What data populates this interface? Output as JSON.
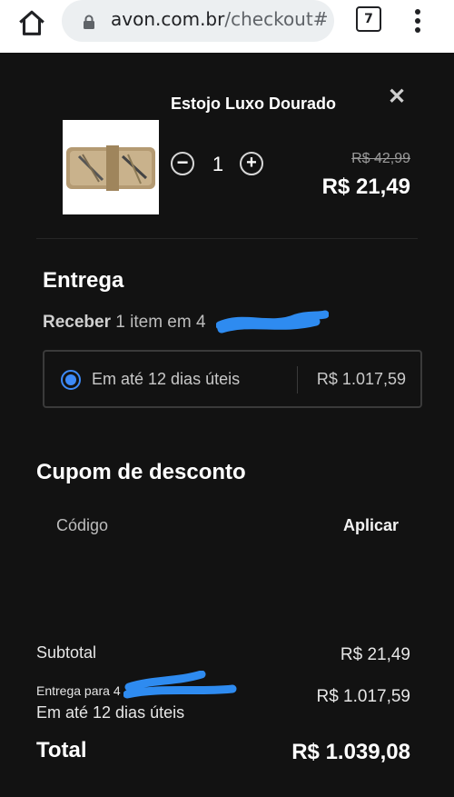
{
  "browser": {
    "url_domain": "avon.com.br",
    "url_path": "/checkout#",
    "tab_count": "7",
    "icons": [
      "home-icon",
      "lock-icon",
      "tabs-icon",
      "more-vert-icon"
    ]
  },
  "cart_item": {
    "name": "Estojo Luxo Dourado",
    "quantity": "1",
    "old_price": "R$ 42,99",
    "price": "R$ 21,49"
  },
  "delivery": {
    "heading": "Entrega",
    "receive_bold": "Receber",
    "receive_text": "1 item em 4",
    "option_label": "Em até 12 dias úteis",
    "option_price": "R$ 1.017,59"
  },
  "coupon": {
    "heading": "Cupom de desconto",
    "placeholder": "Código",
    "apply_label": "Aplicar"
  },
  "summary": {
    "subtotal_label": "Subtotal",
    "subtotal_value": "R$ 21,49",
    "shipping_label": "Entrega para 4",
    "shipping_time": "Em até 12 dias úteis",
    "shipping_value": "R$ 1.017,59",
    "total_label": "Total",
    "total_value": "R$ 1.039,08"
  },
  "colors": {
    "background": "#121212",
    "radio_accent": "#3d8af7",
    "redaction": "#2e8bf0"
  }
}
